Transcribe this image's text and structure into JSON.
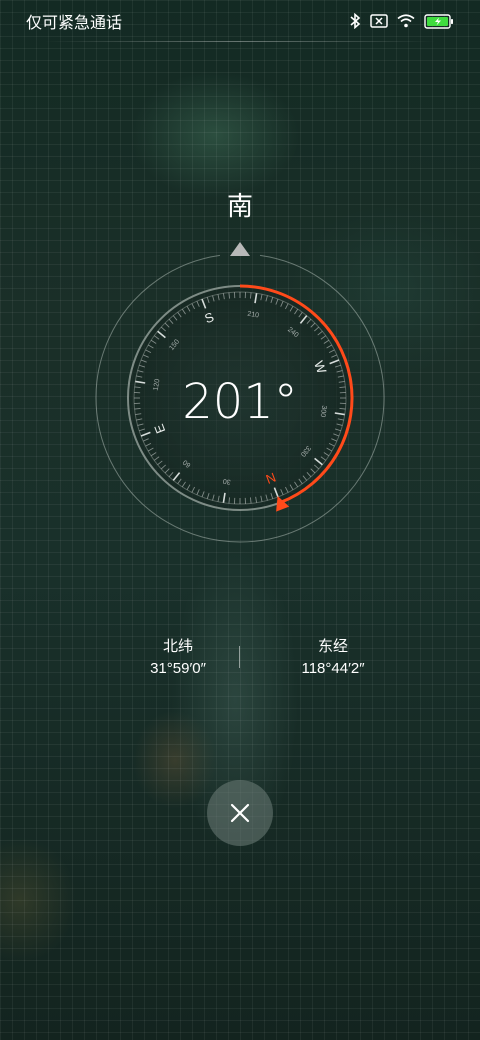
{
  "status_bar": {
    "carrier_text": "仅可紧急通话",
    "icons": [
      "bluetooth-icon",
      "no-sim-icon",
      "wifi-icon",
      "battery-charging-icon"
    ],
    "battery_color": "#3fdc3f"
  },
  "compass": {
    "direction_label": "南",
    "heading_text": "201°",
    "heading_value": 201,
    "accent_color": "#ff4a1a",
    "cardinals": [
      "N",
      "E",
      "S",
      "W"
    ],
    "degree_labels": [
      "30",
      "60",
      "120",
      "150",
      "210",
      "240",
      "300",
      "330"
    ]
  },
  "coordinates": {
    "latitude_label": "北纬",
    "latitude_value": "31°59′0″",
    "longitude_label": "东经",
    "longitude_value": "118°44′2″"
  },
  "controls": {
    "close_icon": "close-icon"
  }
}
